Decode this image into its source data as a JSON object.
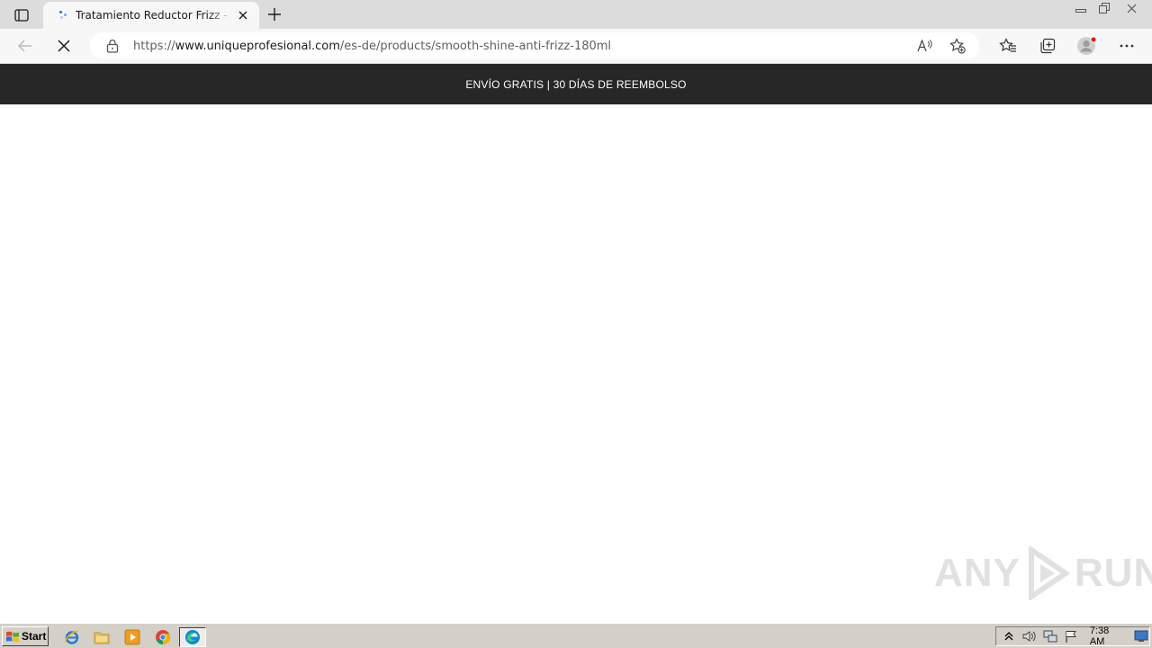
{
  "browser": {
    "tab": {
      "title": "Tratamiento Reductor Frizz - Smooth Shine Anti-Frizz"
    },
    "address_bar": {
      "url_prefix": "https://",
      "url_host": "www.uniqueprofesional.com",
      "url_path": "/es-de/products/smooth-shine-anti-frizz-180ml"
    },
    "icons": {
      "tab_actions": "tab-actions-icon",
      "tab_close": "close-icon",
      "new_tab": "plus-icon",
      "back": "back-arrow-icon",
      "stop": "stop-loading-icon",
      "lock": "lock-icon",
      "read_aloud": "read-aloud-icon",
      "add_favorite": "add-favorite-icon",
      "favorites": "favorites-icon",
      "collections": "collections-icon",
      "profile": "profile-avatar-icon",
      "more": "more-icon"
    }
  },
  "page": {
    "banner_text": "ENVÍO GRATIS | 30 DÍAS DE REEMBOLSO",
    "watermark": {
      "left": "ANY",
      "right": "RUN"
    }
  },
  "taskbar": {
    "start_label": "Start",
    "quick_launch": [
      "internet-explorer-icon",
      "folder-icon",
      "media-player-icon",
      "chrome-icon",
      "edge-icon"
    ],
    "tray_icons": [
      "show-hidden-icon",
      "volume-icon",
      "network-icon",
      "flag-icon"
    ],
    "clock": "7:38 AM"
  },
  "colors": {
    "banner_bg": "#272727",
    "tab_strip": "#dcdcdc",
    "toolbar": "#f7f7f7",
    "taskbar": "#d4d0c8"
  }
}
